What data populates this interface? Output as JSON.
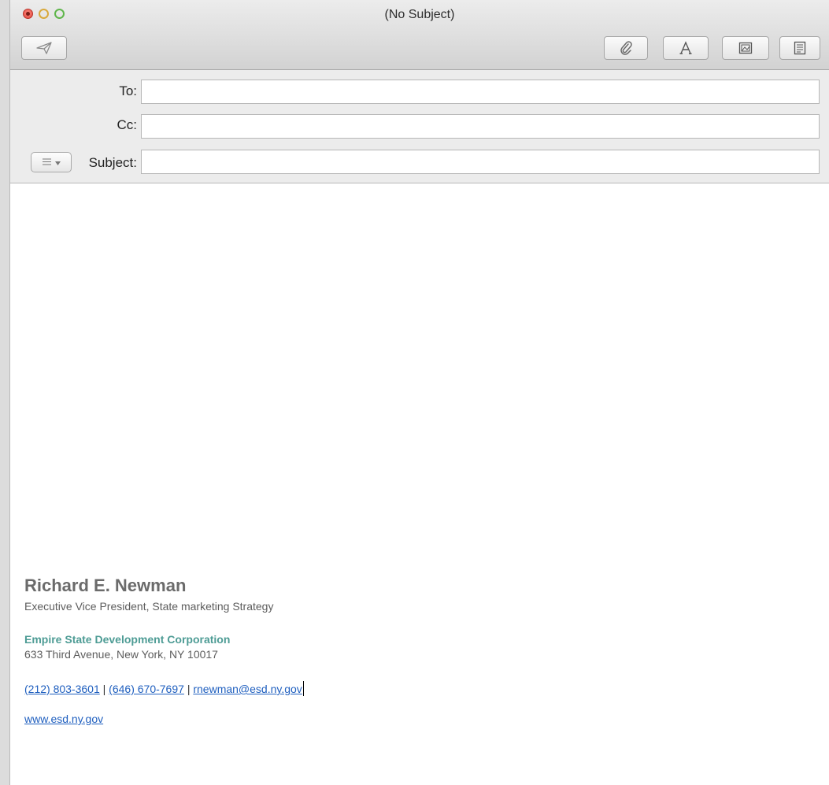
{
  "window": {
    "title": "(No Subject)"
  },
  "toolbar": {
    "send_icon": "paper-plane-icon",
    "attach_icon": "paperclip-icon",
    "fonts_icon": "letter-a-icon",
    "photo_icon": "photo-browser-icon",
    "templates_icon": "stationery-icon"
  },
  "header": {
    "to_label": "To:",
    "cc_label": "Cc:",
    "subject_label": "Subject:",
    "to_value": "",
    "cc_value": "",
    "subject_value": ""
  },
  "signature": {
    "name": "Richard E. Newman",
    "title": "Executive Vice President, State marketing Strategy",
    "company": "Empire State Development Corporation",
    "address": "633 Third Avenue, New York, NY 10017",
    "phone1": "(212) 803-3601",
    "separator": "|",
    "phone2": "(646) 670-7697",
    "email": "rnewman@esd.ny.gov",
    "website": "www.esd.ny.gov"
  },
  "colors": {
    "company_teal": "#4e9c95",
    "link_blue": "#1f5fbf",
    "name_gray": "#6b6b6b"
  }
}
